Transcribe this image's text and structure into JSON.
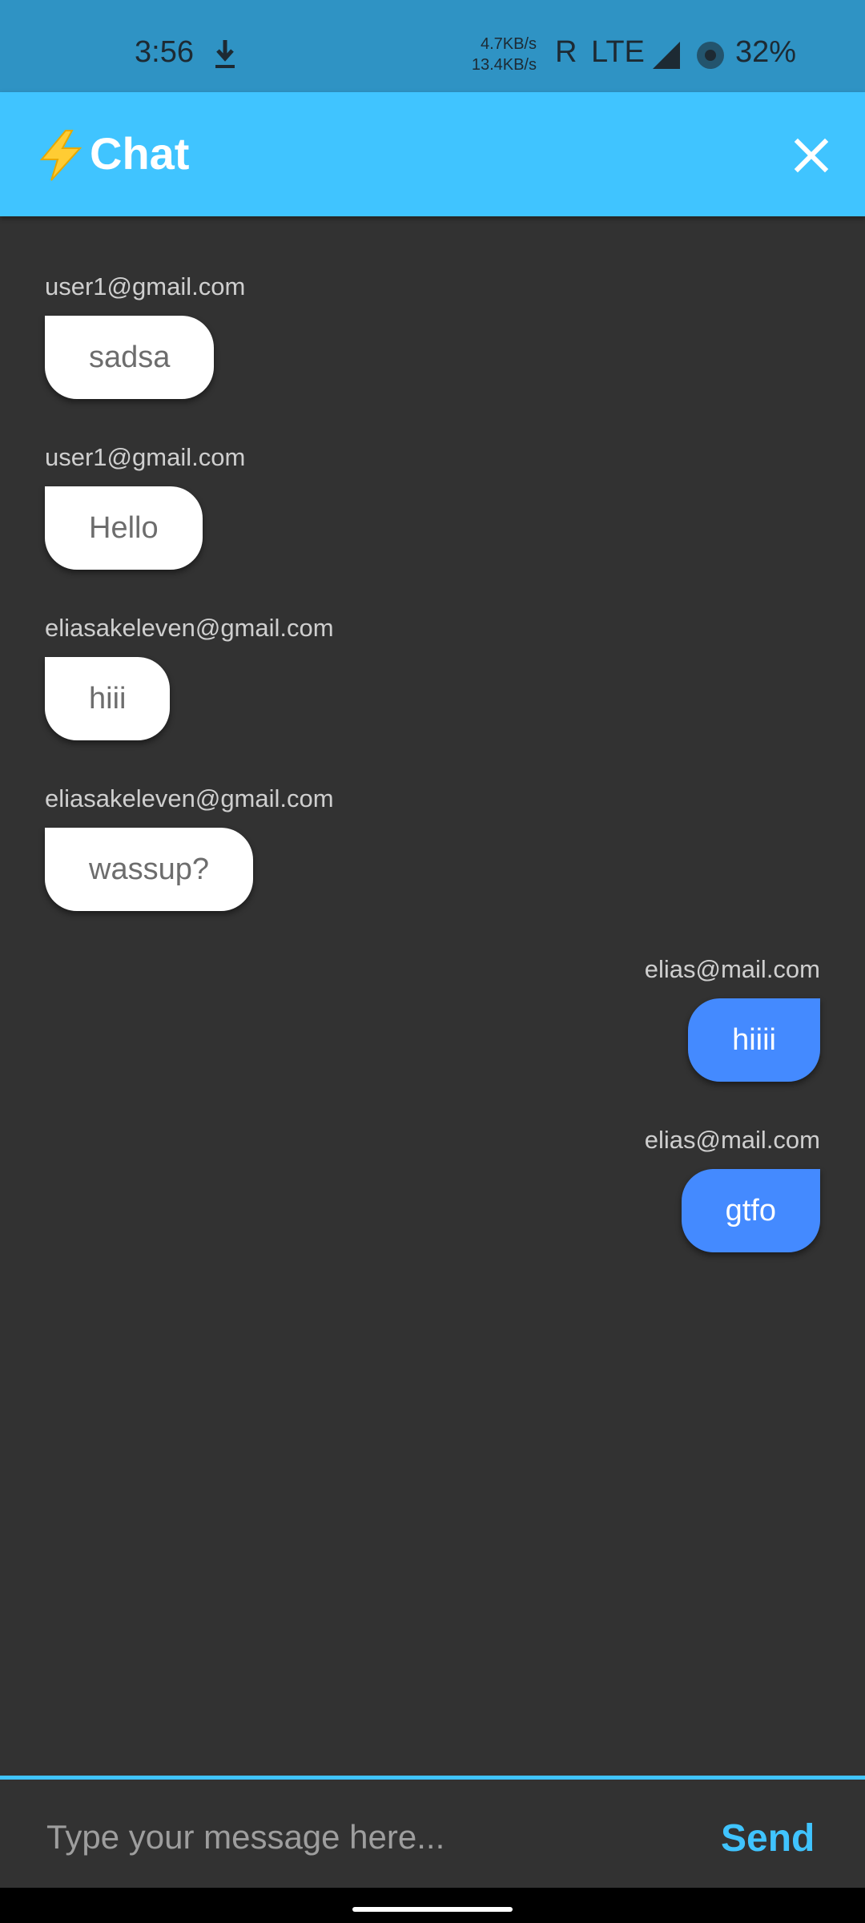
{
  "status_bar": {
    "time": "3:56",
    "speed_up": "4.7KB/s",
    "speed_down": "13.4KB/s",
    "roaming": "R",
    "network": "LTE",
    "battery": "32%"
  },
  "app_bar": {
    "title": "Chat",
    "icon": "lightning-bolt-icon",
    "close_icon": "close-icon",
    "color": "#40c4ff"
  },
  "messages": [
    {
      "sender": "user1@gmail.com",
      "text": "sadsa",
      "side": "left"
    },
    {
      "sender": "user1@gmail.com",
      "text": "Hello",
      "side": "left"
    },
    {
      "sender": "eliasakeleven@gmail.com",
      "text": "hiii",
      "side": "left"
    },
    {
      "sender": "eliasakeleven@gmail.com",
      "text": "wassup?",
      "side": "left"
    },
    {
      "sender": "elias@mail.com",
      "text": "hiiii",
      "side": "right"
    },
    {
      "sender": "elias@mail.com",
      "text": "gtfo",
      "side": "right"
    }
  ],
  "input": {
    "placeholder": "Type your message here...",
    "value": "",
    "send_label": "Send"
  },
  "colors": {
    "background": "#323232",
    "accent": "#40c4ff",
    "own_bubble": "#448aff",
    "other_bubble": "#ffffff"
  }
}
